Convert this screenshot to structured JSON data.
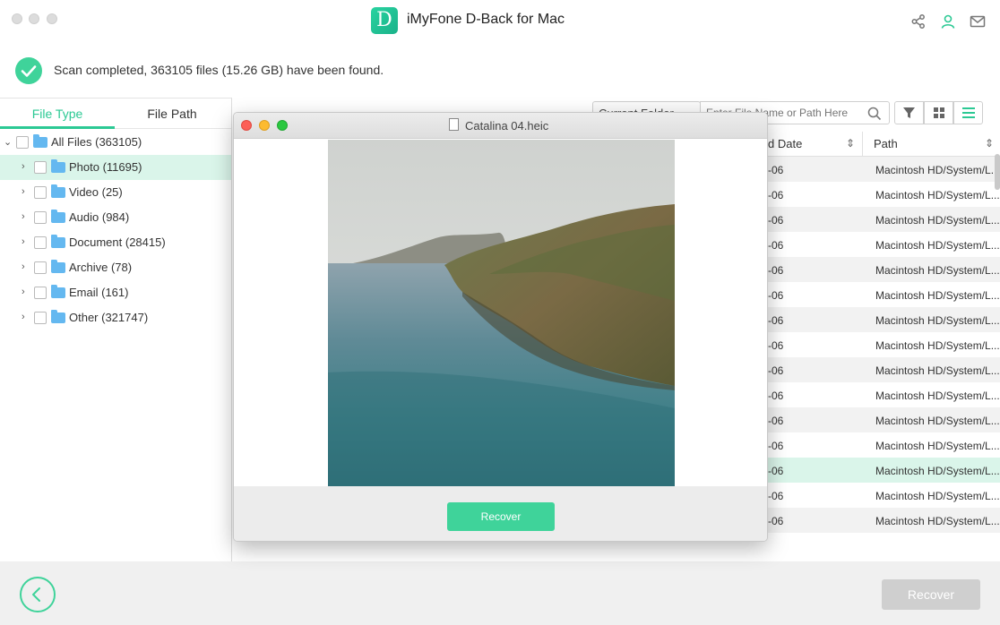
{
  "window": {
    "title": "iMyFone D-Back for Mac",
    "logo_letter": "D"
  },
  "status": {
    "message": "Scan completed, 363105 files (15.26 GB) have been found."
  },
  "tabs": [
    {
      "label": "File Type",
      "active": true
    },
    {
      "label": "File Path",
      "active": false
    }
  ],
  "tree": {
    "root": {
      "label": "All Files (363105)"
    },
    "items": [
      {
        "label": "Photo (11695)",
        "selected": true
      },
      {
        "label": "Video (25)"
      },
      {
        "label": "Audio (984)"
      },
      {
        "label": "Document (28415)"
      },
      {
        "label": "Archive (78)"
      },
      {
        "label": "Email (161)"
      },
      {
        "label": "Other (321747)"
      }
    ]
  },
  "toolbar": {
    "folder_filter": "Current Folder",
    "search_placeholder": "Enter File Name or Path Here"
  },
  "table": {
    "columns": {
      "date": "d Date",
      "path": "Path"
    },
    "rows": [
      {
        "date": "-06",
        "path": "Macintosh HD/System/L..."
      },
      {
        "date": "-06",
        "path": "Macintosh HD/System/L..."
      },
      {
        "date": "-06",
        "path": "Macintosh HD/System/L..."
      },
      {
        "date": "-06",
        "path": "Macintosh HD/System/L..."
      },
      {
        "date": "-06",
        "path": "Macintosh HD/System/L..."
      },
      {
        "date": "-06",
        "path": "Macintosh HD/System/L..."
      },
      {
        "date": "-06",
        "path": "Macintosh HD/System/L..."
      },
      {
        "date": "-06",
        "path": "Macintosh HD/System/L..."
      },
      {
        "date": "-06",
        "path": "Macintosh HD/System/L..."
      },
      {
        "date": "-06",
        "path": "Macintosh HD/System/L..."
      },
      {
        "date": "-06",
        "path": "Macintosh HD/System/L..."
      },
      {
        "date": "-06",
        "path": "Macintosh HD/System/L..."
      },
      {
        "date": "-06",
        "path": "Macintosh HD/System/L..."
      },
      {
        "date": "-06",
        "path": "Macintosh HD/System/L..."
      },
      {
        "date": "-06",
        "path": "Macintosh HD/System/L..."
      }
    ]
  },
  "preview": {
    "filename": "Catalina 04.heic",
    "recover_label": "Recover"
  },
  "bottom": {
    "recover_label": "Recover"
  },
  "colors": {
    "accent": "#3fd39a",
    "selection": "#daf5ea",
    "disabled": "#cfcfcf"
  }
}
